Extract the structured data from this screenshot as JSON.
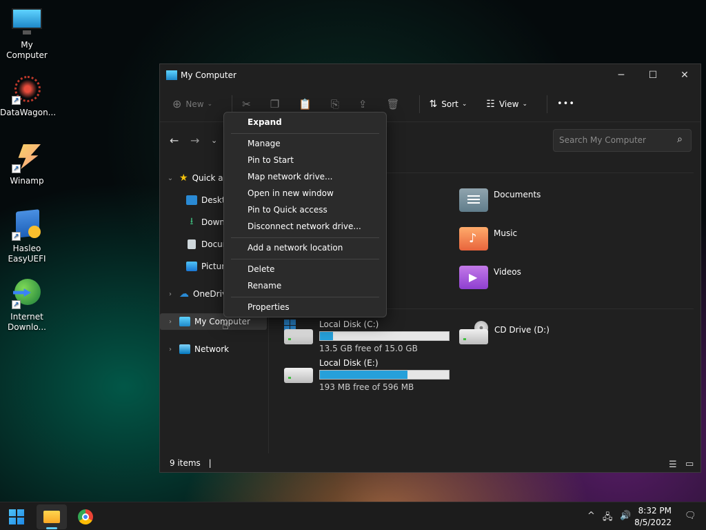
{
  "desktop": {
    "icons": [
      {
        "label": "My Computer"
      },
      {
        "label": "DataWagon..."
      },
      {
        "label": "Winamp"
      },
      {
        "label_line1": "Hasleo",
        "label_line2": "EasyUEFI"
      },
      {
        "label_line1": "Internet",
        "label_line2": "Downlo..."
      }
    ]
  },
  "window": {
    "title": "My Computer",
    "controls": {
      "minimize": "─",
      "maximize": "☐",
      "close": "✕"
    }
  },
  "toolbar": {
    "new_label": "New",
    "sort_label": "Sort",
    "view_label": "View",
    "more_label": "•••"
  },
  "search": {
    "placeholder": "Search My Computer"
  },
  "navpane": {
    "items": [
      {
        "label": "Quick a"
      },
      {
        "label": "Deskto"
      },
      {
        "label": "Downl"
      },
      {
        "label": "Docum"
      },
      {
        "label": "Pictur"
      },
      {
        "label": "OneDriv"
      },
      {
        "label": "My Computer"
      },
      {
        "label": "Network"
      }
    ]
  },
  "folders": [
    {
      "label": "Documents"
    },
    {
      "label": "Music"
    },
    {
      "label": "Videos"
    }
  ],
  "drives": [
    {
      "name": "Local Disk (C:)",
      "free": "13.5 GB free of 15.0 GB",
      "used_fraction": 0.1
    },
    {
      "name": "CD Drive (D:)"
    },
    {
      "name": "Local Disk (E:)",
      "free": "193 MB free of 596 MB",
      "used_fraction": 0.68
    }
  ],
  "status": {
    "items": "9 items"
  },
  "context_menu": {
    "items": [
      {
        "label": "Expand"
      },
      {
        "label": "Manage"
      },
      {
        "label": "Pin to Start"
      },
      {
        "label": "Map network drive..."
      },
      {
        "label": "Open in new window"
      },
      {
        "label": "Pin to Quick access"
      },
      {
        "label": "Disconnect network drive..."
      },
      {
        "label": "Add a network location"
      },
      {
        "label": "Delete"
      },
      {
        "label": "Rename"
      },
      {
        "label": "Properties"
      }
    ]
  },
  "taskbar": {
    "time": "8:32 PM",
    "date": "8/5/2022"
  },
  "colors": {
    "accent": "#26a0da",
    "window_bg": "#202020",
    "menu_bg": "#2b2b2b"
  }
}
